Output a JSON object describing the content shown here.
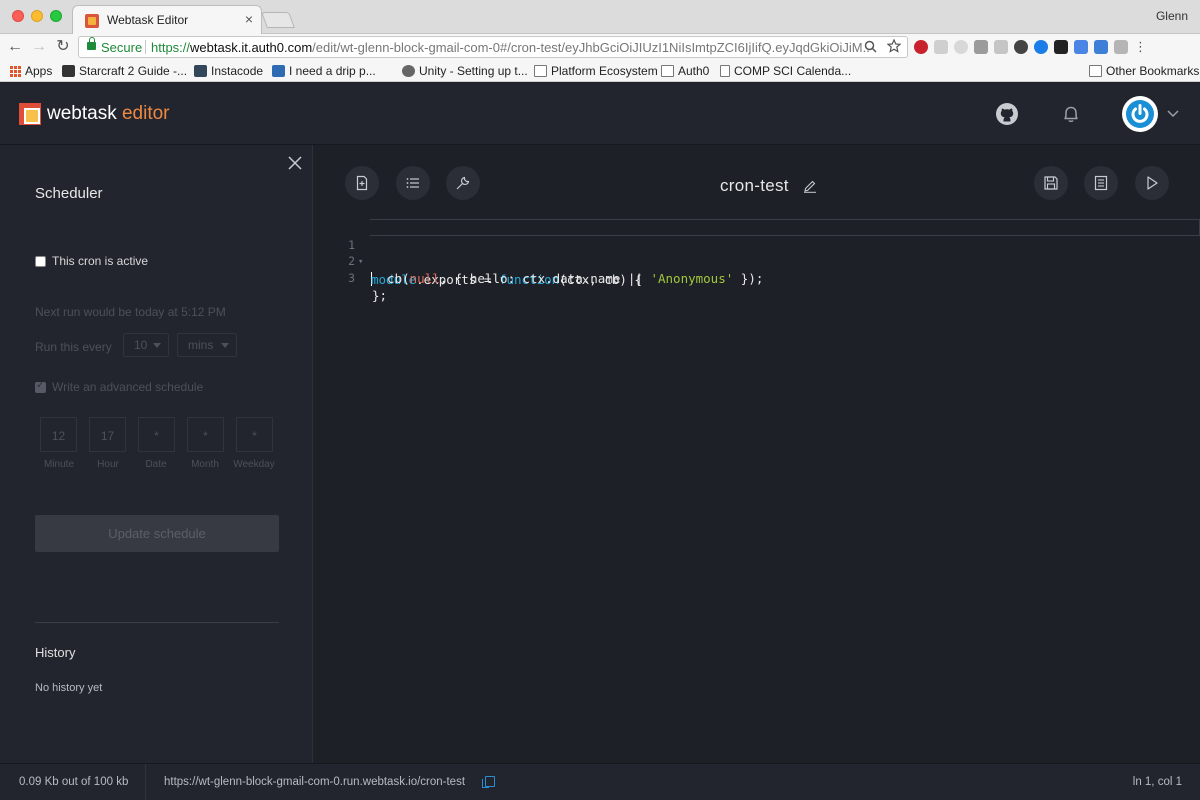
{
  "browser": {
    "tab_title": "Webtask Editor",
    "tab_close": "×",
    "profile": "Glenn",
    "secure_label": "Secure",
    "url_scheme": "https://",
    "url_host": "webtask.it.auth0.com",
    "url_path": "/edit/wt-glenn-block-gmail-com-0#/cron-test/eyJhbGciOiJIUzI1NiIsImtpZCI6IjIifQ.eyJqdGkiOiJiM...",
    "bookmarks": [
      {
        "label": "Apps",
        "icon": "apps-grid-icon"
      },
      {
        "label": "Starcraft 2 Guide -...",
        "icon": "starcraft-icon"
      },
      {
        "label": "Instacode",
        "icon": "instacode-icon"
      },
      {
        "label": "I need a drip p...",
        "icon": "site-icon"
      },
      {
        "label": "Unity - Setting up t...",
        "icon": "unity-icon"
      },
      {
        "label": "Platform Ecosystem",
        "icon": "folder-icon"
      },
      {
        "label": "Auth0",
        "icon": "folder-icon"
      },
      {
        "label": "COMP SCI Calenda...",
        "icon": "page-icon"
      }
    ],
    "other_bookmarks": "Other Bookmarks"
  },
  "header": {
    "brand_name": "webtask",
    "brand_accent": "editor",
    "accent_color": "#eb8944"
  },
  "sidebar": {
    "title": "Scheduler",
    "active_label": "This cron is active",
    "next_run": "Next run would be today at 5:12 PM",
    "run_every_label": "Run this every",
    "interval_value": "10",
    "interval_unit": "mins",
    "advanced_label": "Write an advanced schedule",
    "cron_fields": [
      {
        "value": "12",
        "label": "Minute"
      },
      {
        "value": "17",
        "label": "Hour"
      },
      {
        "value": "*",
        "label": "Date"
      },
      {
        "value": "*",
        "label": "Month"
      },
      {
        "value": "*",
        "label": "Weekday"
      }
    ],
    "update_button": "Update schedule",
    "history_title": "History",
    "history_empty": "No history yet"
  },
  "editor": {
    "file_name": "cron-test",
    "line_numbers": [
      "1",
      "2",
      "3"
    ]
  },
  "status": {
    "size": "0.09 Kb out of 100 kb",
    "url": "https://wt-glenn-block-gmail-com-0.run.webtask.io/cron-test",
    "cursor": "ln 1, col 1"
  }
}
